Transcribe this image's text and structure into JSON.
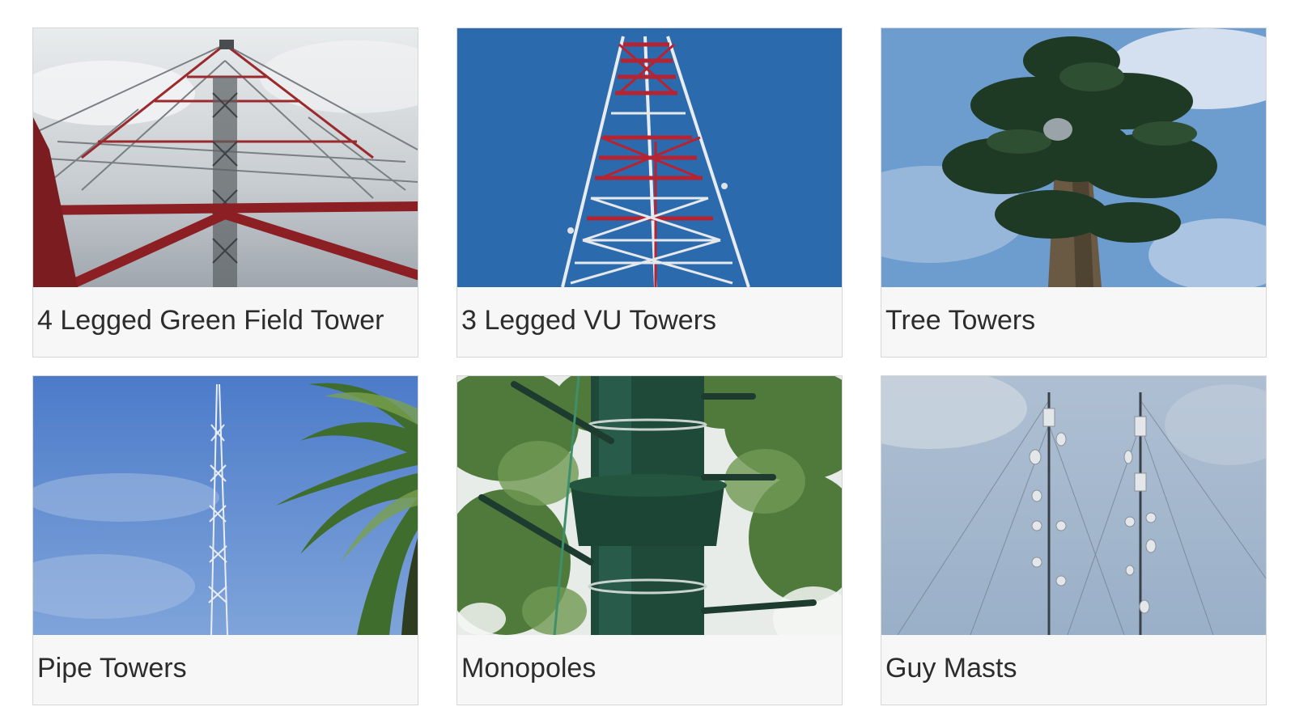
{
  "gallery": {
    "items": [
      {
        "title": "4 Legged Green Field Tower",
        "image": "lattice-tower-photo"
      },
      {
        "title": "3 Legged VU Towers",
        "image": "red-white-tower-photo"
      },
      {
        "title": "Tree Towers",
        "image": "camouflage-tree-tower-photo"
      },
      {
        "title": "Pipe Towers",
        "image": "pipe-tower-palm-photo"
      },
      {
        "title": "Monopoles",
        "image": "green-monopole-photo"
      },
      {
        "title": "Guy Masts",
        "image": "guyed-masts-photo"
      }
    ]
  }
}
